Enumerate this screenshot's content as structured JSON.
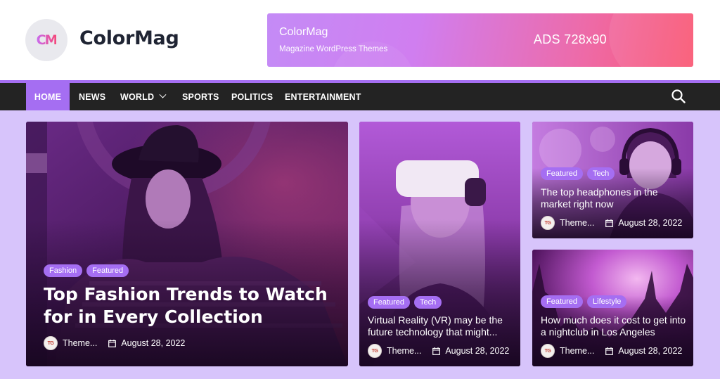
{
  "header": {
    "logo_text": "CM",
    "site_title": "ColorMag",
    "ad": {
      "title": "ColorMag",
      "subtitle": "Magazine WordPress Themes",
      "size_label": "ADS 728x90"
    }
  },
  "nav": {
    "items": [
      {
        "label": "HOME",
        "active": true
      },
      {
        "label": "NEWS"
      },
      {
        "label": "WORLD",
        "has_dropdown": true
      },
      {
        "label": "SPORTS"
      },
      {
        "label": "POLITICS"
      },
      {
        "label": "ENTERTAINMENT"
      }
    ],
    "search_icon": "search-icon"
  },
  "posts": [
    {
      "tags": [
        "Fashion",
        "Featured"
      ],
      "title": "Top Fashion Trends to Watch for in Every Collection",
      "author_badge": "TG",
      "author": "Theme...",
      "date": "August 28, 2022"
    },
    {
      "tags": [
        "Featured",
        "Tech"
      ],
      "title": "Virtual Reality (VR) may be the future technology that might...",
      "author_badge": "TG",
      "author": "Theme...",
      "date": "August 28, 2022"
    },
    {
      "tags": [
        "Featured",
        "Tech"
      ],
      "title": "The top headphones in the market right now",
      "author_badge": "TG",
      "author": "Theme...",
      "date": "August 28, 2022"
    },
    {
      "tags": [
        "Featured",
        "Lifestyle"
      ],
      "title": "How much does it cost to get into a nightclub in Los Angeles",
      "author_badge": "TG",
      "author": "Theme...",
      "date": "August 28, 2022"
    }
  ],
  "colors": {
    "accent": "#a56ef2",
    "nav_bg": "#232323",
    "page_bg": "#d7c4fb",
    "title_text": "#1f2433"
  }
}
